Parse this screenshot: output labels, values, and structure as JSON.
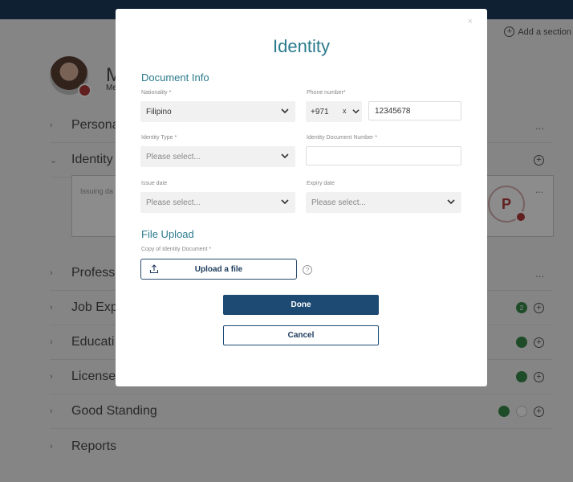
{
  "background": {
    "add_section": "Add a section",
    "profile_initial": "M",
    "profile_sub": "Me",
    "sections": [
      {
        "label": "Personal",
        "right": "..."
      },
      {
        "label": "Identity",
        "right": "plus"
      },
      {
        "label": "Professi",
        "right": "..."
      },
      {
        "label": "Job Exp",
        "right": "dot-count",
        "count": "2"
      },
      {
        "label": "Educati",
        "right": "dot"
      },
      {
        "label": "License",
        "right": "dot"
      },
      {
        "label": "Good Standing",
        "right": "dot-pair"
      },
      {
        "label": "Reports",
        "right": "none"
      }
    ],
    "identity_card_text": "Issuing da",
    "card_menu": "..."
  },
  "modal": {
    "close": "×",
    "title": "Identity",
    "document_info_title": "Document Info",
    "nationality": {
      "label": "Nationality *",
      "value": "Filipino"
    },
    "phone": {
      "label": "Phone number*",
      "code": "+971",
      "clear": "x",
      "number": "12345678"
    },
    "identity_type": {
      "label": "Identity Type *",
      "placeholder": "Please select..."
    },
    "identity_number": {
      "label": "Identity Document Number *",
      "value": ""
    },
    "issue_date": {
      "label": "Issue date",
      "placeholder": "Please select..."
    },
    "expiry_date": {
      "label": "Expiry date",
      "placeholder": "Please select..."
    },
    "file_upload_title": "File Upload",
    "copy_label": "Copy of Identity Document *",
    "upload_label": "Upload a file",
    "help": "?",
    "done": "Done",
    "cancel": "Cancel"
  },
  "colors": {
    "accent": "#2a7a8c",
    "primary": "#1c4a73",
    "status_green": "#3a8a4a"
  }
}
